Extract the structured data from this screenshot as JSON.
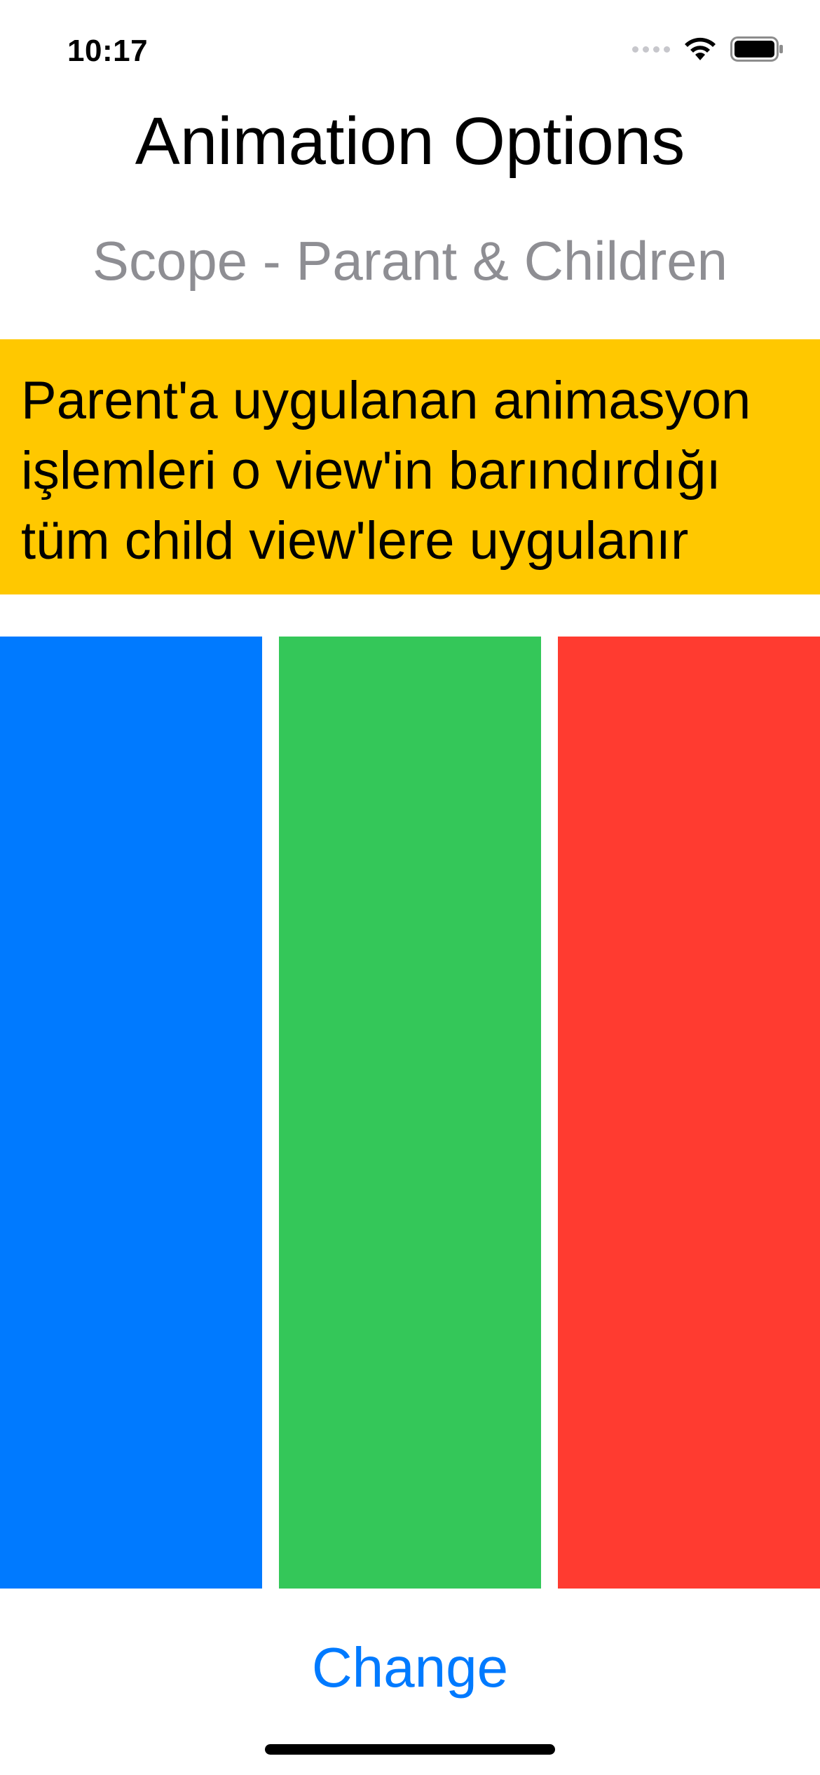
{
  "status_bar": {
    "time": "10:17"
  },
  "header": {
    "title": "Animation Options",
    "subtitle": "Scope - Parant & Children"
  },
  "banner": {
    "text": "Parent'a uygulanan animasyon işlemleri o view'in barındırdığı tüm child view'lere uygulanır",
    "color": "#ffc800"
  },
  "child_views": [
    {
      "color": "#007aff"
    },
    {
      "color": "#34c759"
    },
    {
      "color": "#ff3b30"
    }
  ],
  "action": {
    "label": "Change",
    "color": "#007aff"
  },
  "icons": [
    "cellular-signal-icon",
    "wifi-icon",
    "battery-icon"
  ]
}
